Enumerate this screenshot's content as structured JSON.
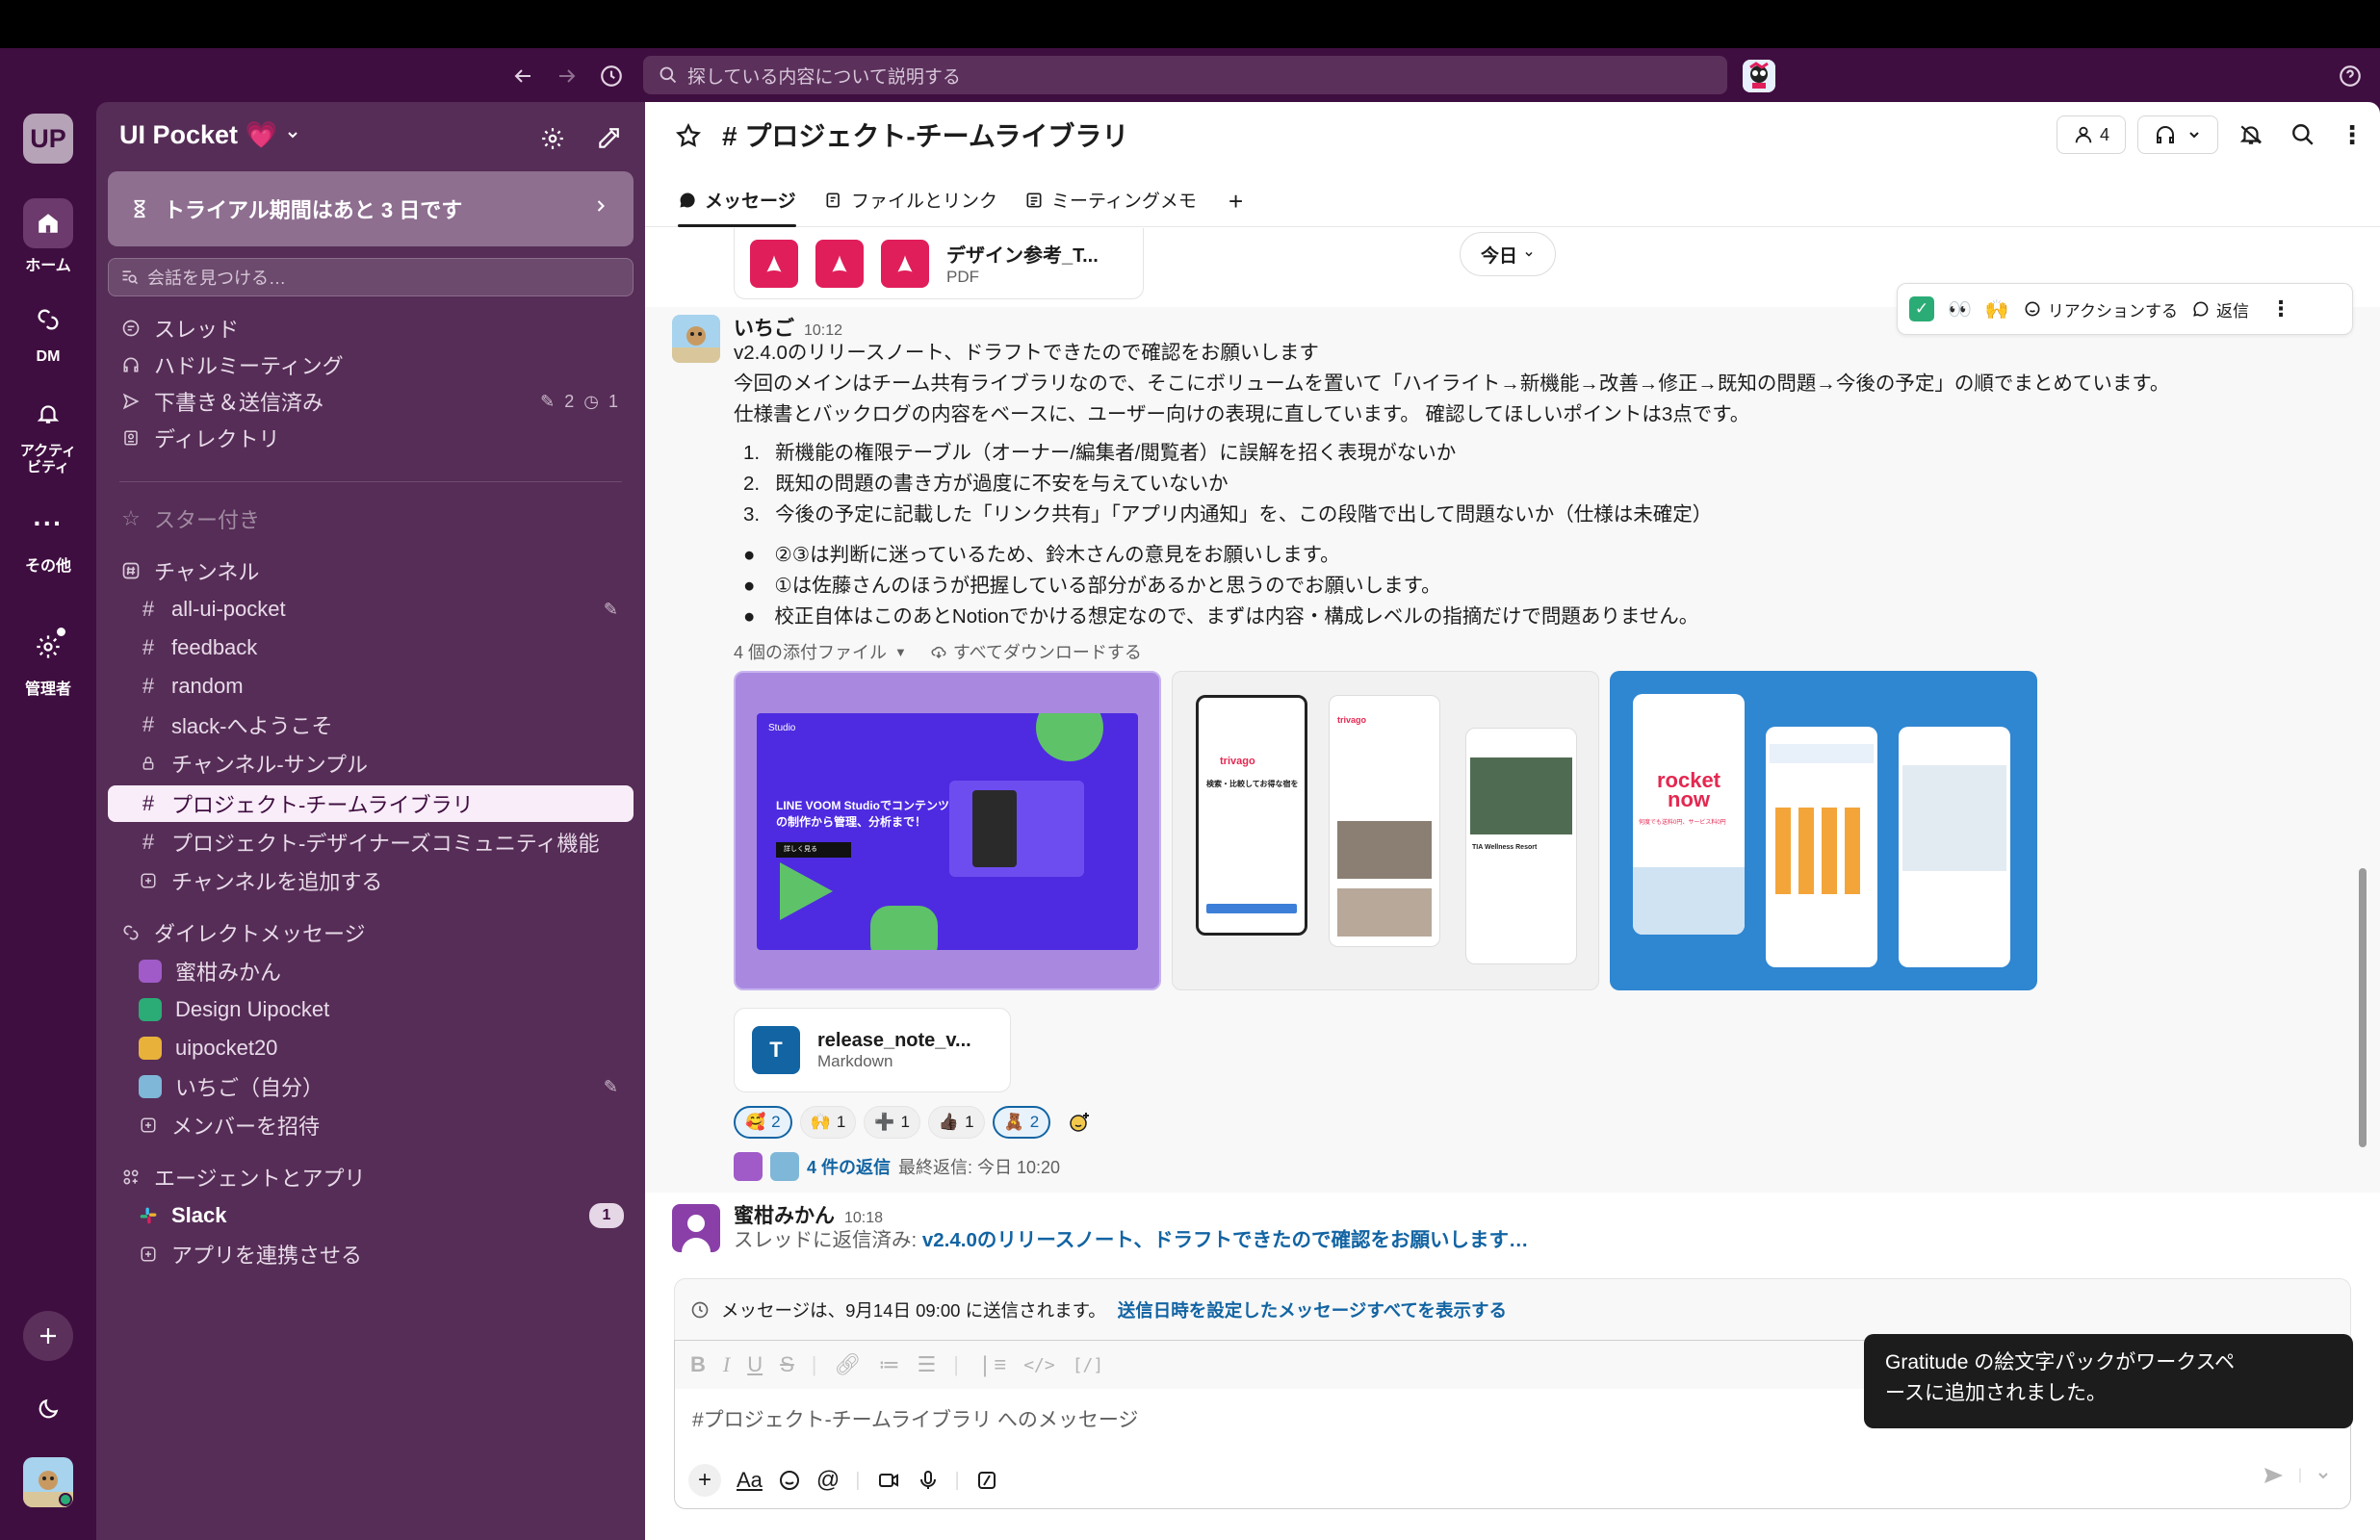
{
  "search": {
    "placeholder": "探している内容について説明する"
  },
  "rail": {
    "workspace_initials": "UP",
    "home": "ホーム",
    "dm": "DM",
    "activity": "アクティビティ",
    "more": "その他",
    "admin": "管理者"
  },
  "sidebar": {
    "workspace_name": "UI Pocket 💗",
    "trial_banner": "トライアル期間はあと 3 日です",
    "find_placeholder": "会話を見つける…",
    "nav": [
      {
        "label": "スレッド"
      },
      {
        "label": "ハドルミーティング"
      },
      {
        "label": "下書き＆送信済み",
        "drafts": "2",
        "scheduled": "1"
      },
      {
        "label": "ディレクトリ"
      }
    ],
    "starred": "スター付き",
    "channels_header": "チャンネル",
    "channels": [
      "all-ui-pocket",
      "feedback",
      "random",
      "slack-へようこそ",
      "チャンネル-サンプル",
      "プロジェクト-チームライブラリ",
      "プロジェクト-デザイナーズコミュニティ機能"
    ],
    "add_channel": "チャンネルを追加する",
    "dm_header": "ダイレクトメッセージ",
    "dms": [
      "蜜柑みかん",
      "Design Uipocket",
      "uipocket20",
      "いちご（自分）"
    ],
    "invite": "メンバーを招待",
    "apps_header": "エージェントとアプリ",
    "apps": [
      {
        "label": "Slack",
        "badge": "1"
      }
    ],
    "connect_app": "アプリを連携させる"
  },
  "channel": {
    "title": "# プロジェクト-チームライブラリ",
    "member_count": "4",
    "tabs": [
      "メッセージ",
      "ファイルとリンク",
      "ミーティングメモ"
    ]
  },
  "top_file": {
    "name": "デザイン参考_T...",
    "type": "PDF"
  },
  "date_divider": "今日",
  "hover_actions": {
    "react": "リアクションする",
    "reply": "返信"
  },
  "message1": {
    "author": "いちご",
    "time": "10:12",
    "lines": [
      "v2.4.0のリリースノート、ドラフトできたので確認をお願いします",
      "今回のメインはチーム共有ライブラリなので、そこにボリュームを置いて「ハイライト→新機能→改善→修正→既知の問題→今後の予定」の順でまとめています。",
      "仕様書とバックログの内容をベースに、ユーザー向けの表現に直しています。 確認してほしいポイントは3点です。"
    ],
    "ordered": [
      "新機能の権限テーブル（オーナー/編集者/閲覧者）に誤解を招く表現がないか",
      "既知の問題の書き方が過度に不安を与えていないか",
      "今後の予定に記載した「リンク共有」「アプリ内通知」を、この段階で出して問題ないか（仕様は未確定）"
    ],
    "bullets": [
      "②③は判断に迷っているため、鈴木さんの意見をお願いします。",
      "①は佐藤さんのほうが把握している部分があるかと思うのでお願いします。",
      "校正自体はこのあとNotionでかける想定なので、まずは内容・構成レベルの指摘だけで問題ありません。"
    ],
    "attachments_label": "4 個の添付ファイル",
    "download_all": "すべてダウンロードする",
    "image1_text": "LINE VOOM Studioでコンテンツの制作から管理、分析まで！",
    "image1_brand": "Studio",
    "image1_button": "詳しく見る",
    "image2_brand": "trivago",
    "image2_heading": "検索・比較してお得な宿を",
    "image2_resort": "TIA Wellness Resort",
    "image3_brand": "rocket now",
    "image3_tagline": "何度でも送料0円、サービス料0円",
    "file": {
      "name": "release_note_v...",
      "type": "Markdown",
      "icon_letter": "T"
    },
    "reactions": [
      {
        "emoji": "🥰",
        "count": "2"
      },
      {
        "emoji": "🙌",
        "count": "1"
      },
      {
        "emoji": "➕",
        "count": "1"
      },
      {
        "emoji": "👍🏿",
        "count": "1"
      },
      {
        "emoji": "🧸",
        "count": "2"
      }
    ],
    "thread_count": "4 件の返信",
    "thread_last": "最終返信: 今日 10:20"
  },
  "message2": {
    "author": "蜜柑みかん",
    "time": "10:18",
    "prefix": "スレッドに返信済み:",
    "link": "v2.4.0のリリースノート、ドラフトできたので確認をお願いします…"
  },
  "composer": {
    "scheduled_text": "メッセージは、9月14日 09:00 に送信されます。",
    "scheduled_link": "送信日時を設定したメッセージすべてを表示する",
    "placeholder": "#プロジェクト-チームライブラリ へのメッセージ",
    "aa": "Aa"
  },
  "toast": {
    "line1": "Gratitude の絵文字パックがワークスペ",
    "line2": "ースに追加されました。"
  },
  "colors": {
    "aubergine": "#3f0e40",
    "sidebar": "#562d57",
    "link": "#1264a3",
    "pdf": "#e01e5a"
  }
}
